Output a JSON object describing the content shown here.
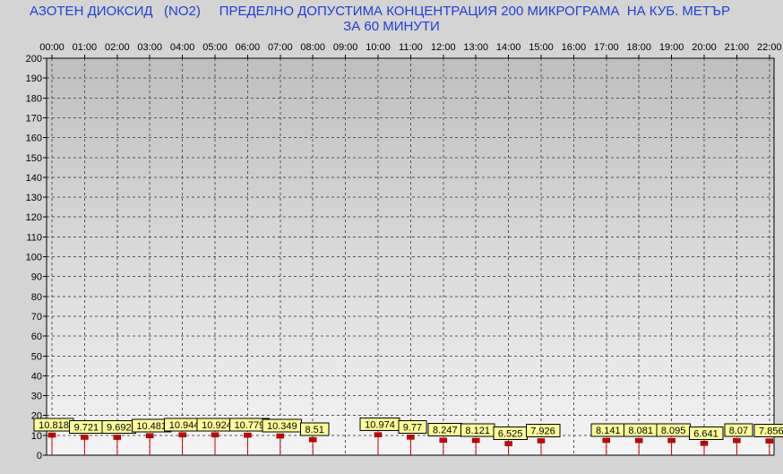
{
  "chart_data": {
    "type": "bar",
    "title_line1": "АЗОТЕН ДИОКСИД   (NO2)     ПРЕДЕЛНО ДОПУСТИМА КОНЦЕНТРАЦИЯ 200 МИКРОГРАМА  НА КУБ. МЕТЪР",
    "title_line2": "ЗА 60 МИНУТИ",
    "categories": [
      "00:00",
      "01:00",
      "02:00",
      "03:00",
      "04:00",
      "05:00",
      "06:00",
      "07:00",
      "08:00",
      "09:00",
      "10:00",
      "11:00",
      "12:00",
      "13:00",
      "14:00",
      "15:00",
      "16:00",
      "17:00",
      "18:00",
      "19:00",
      "20:00",
      "21:00",
      "22:00"
    ],
    "values": [
      10.818,
      9.721,
      9.692,
      10.481,
      10.944,
      10.924,
      10.779,
      10.349,
      8.51,
      null,
      10.974,
      9.77,
      8.247,
      8.121,
      6.525,
      7.926,
      null,
      8.141,
      8.081,
      8.095,
      6.641,
      8.07,
      7.856
    ],
    "value_labels": [
      "10.818",
      "9.721",
      "9.692",
      "10.481",
      "10.944",
      "10.924",
      "10.779",
      "10.349",
      "8.51",
      null,
      "10.974",
      "9.77",
      "8.247",
      "8.121",
      "6.525",
      "7.926",
      null,
      "8.141",
      "8.081",
      "8.095",
      "6.641",
      "8.07",
      "7.856"
    ],
    "y_ticks": [
      0,
      10,
      20,
      30,
      40,
      50,
      60,
      70,
      80,
      90,
      100,
      110,
      120,
      130,
      140,
      150,
      160,
      170,
      180,
      190,
      200
    ],
    "ylim": [
      0,
      200
    ],
    "grid": true,
    "colors": {
      "title": "#1f3fd6",
      "bar": "#cc0000",
      "label_bg": "#ffff99",
      "plot_top": "#bfbfbf",
      "plot_bottom": "#f4f4f4",
      "grid": "#555555"
    }
  }
}
